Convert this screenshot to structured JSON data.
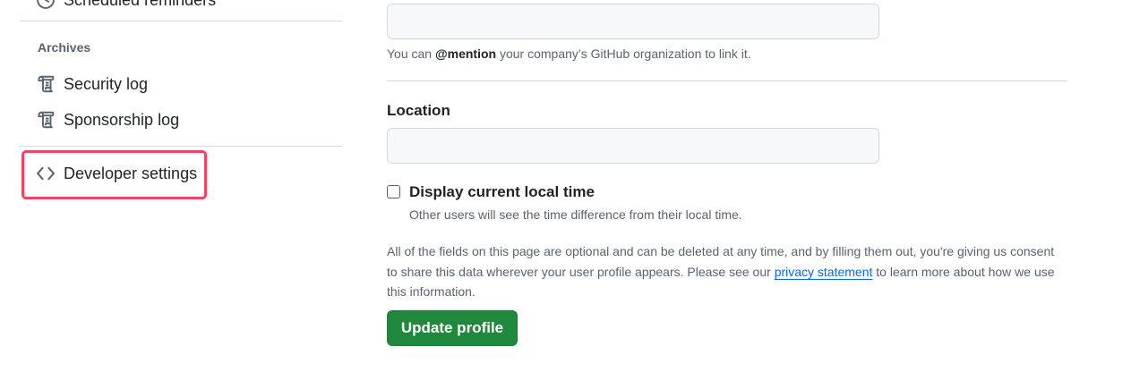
{
  "sidebar": {
    "cut_item": {
      "label": "Scheduled reminders",
      "icon": "clock-icon"
    },
    "archives_heading": "Archives",
    "archive_items": [
      {
        "label": "Security log",
        "icon": "log-icon"
      },
      {
        "label": "Sponsorship log",
        "icon": "log-icon"
      }
    ],
    "developer_settings": {
      "label": "Developer settings",
      "icon": "code-icon",
      "highlight_color": "#f0445f"
    }
  },
  "form": {
    "company": {
      "value": "",
      "hint_prefix": "You can ",
      "hint_mention": "@mention",
      "hint_suffix": " your company’s GitHub organization to link it."
    },
    "location": {
      "label": "Location",
      "value": ""
    },
    "local_time": {
      "label": "Display current local time",
      "hint": "Other users will see the time difference from their local time.",
      "checked": false
    },
    "note": {
      "before_link": "All of the fields on this page are optional and can be deleted at any time, and by filling them out, you're giving us consent to share this data wherever your user profile appears. Please see our ",
      "link_text": "privacy statement",
      "after_link": " to learn more about how we use this information."
    },
    "submit_label": "Update profile"
  },
  "colors": {
    "primary_button": "#1f883d",
    "link": "#0969da",
    "muted_text": "#59636e",
    "border": "#d1d9e0"
  }
}
